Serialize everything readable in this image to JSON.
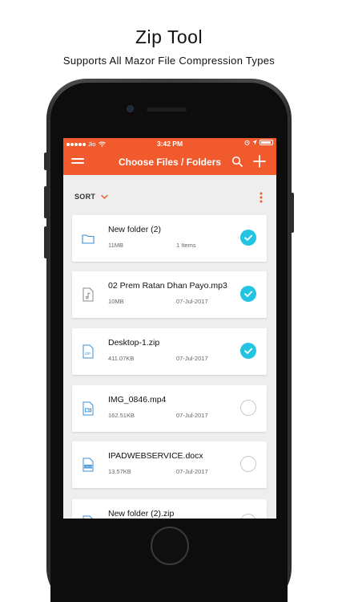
{
  "promo": {
    "title": "Zip Tool",
    "subtitle": "Supports All Mazor File Compression Types"
  },
  "status_bar": {
    "carrier": "Jio",
    "time": "3:42 PM"
  },
  "header": {
    "title": "Choose Files / Folders",
    "icons": [
      "menu-icon",
      "search-icon",
      "plus-icon"
    ]
  },
  "sort": {
    "label": "SORT"
  },
  "files": [
    {
      "name": "New folder (2)",
      "size": "11MB",
      "detail": "1 Items",
      "icon": "folder-icon",
      "checked": true
    },
    {
      "name": "02 Prem Ratan Dhan Payo.mp3",
      "size": "10MB",
      "detail": "07-Jul-2017",
      "icon": "audio-file-icon",
      "checked": true
    },
    {
      "name": "Desktop-1.zip",
      "size": "411.07KB",
      "detail": "07-Jul-2017",
      "icon": "zip-file-icon",
      "checked": true
    },
    {
      "name": "IMG_0846.mp4",
      "size": "162.51KB",
      "detail": "07-Jul-2017",
      "icon": "video-file-icon",
      "checked": false
    },
    {
      "name": "IPADWEBSERVICE.docx",
      "size": "13.57KB",
      "detail": "07-Jul-2017",
      "icon": "docx-file-icon",
      "checked": false
    },
    {
      "name": "New folder (2).zip",
      "size": "",
      "detail": "",
      "icon": "zip-file-icon",
      "checked": false
    }
  ],
  "colors": {
    "accent": "#f05a2c",
    "check": "#22c4e1",
    "icon": "#3a8fd6"
  }
}
